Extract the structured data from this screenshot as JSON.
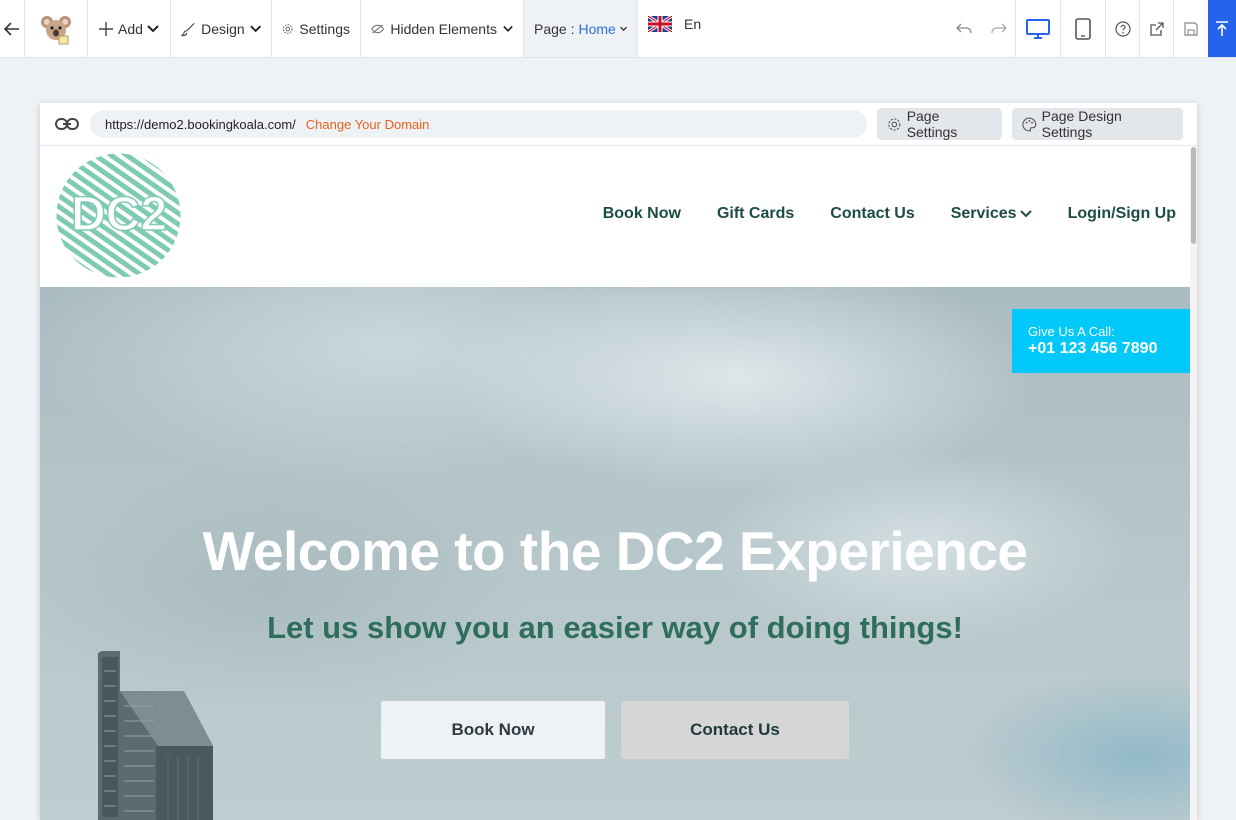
{
  "toolbar": {
    "add_label": "Add",
    "design_label": "Design",
    "settings_label": "Settings",
    "hidden_elements_label": "Hidden Elements",
    "page_label": "Page :",
    "page_value": "Home",
    "language": "En"
  },
  "editor": {
    "url": "https://demo2.bookingkoala.com/",
    "change_domain": "Change Your Domain",
    "page_settings": "Page Settings",
    "page_design_settings": "Page Design Settings"
  },
  "site": {
    "logo_text": "DC2",
    "nav": [
      "Book Now",
      "Gift Cards",
      "Contact Us",
      "Services",
      "Login/Sign Up"
    ],
    "call_label": "Give Us A Call:",
    "call_number": "+01 123 456 7890",
    "hero_title": "Welcome to the DC2 Experience",
    "hero_subtitle": "Let us show you an easier way of doing things!",
    "btn_book": "Book Now",
    "btn_contact": "Contact Us"
  },
  "colors": {
    "accent_blue": "#2563eb",
    "link_orange": "#e8621a",
    "nav_green": "#1c4c43",
    "logo_teal": "#7fcab5",
    "call_cyan": "#00c8f8",
    "subtitle_green": "#2f6e5b"
  },
  "icons": [
    "back-arrow-icon",
    "koala-logo-icon",
    "plus-icon",
    "brush-icon",
    "gear-icon",
    "eye-slash-icon",
    "chevron-down-icon",
    "uk-flag-icon",
    "undo-icon",
    "redo-icon",
    "desktop-icon",
    "tablet-icon",
    "help-icon",
    "external-link-icon",
    "save-icon",
    "publish-icon",
    "link-icon",
    "palette-icon"
  ]
}
